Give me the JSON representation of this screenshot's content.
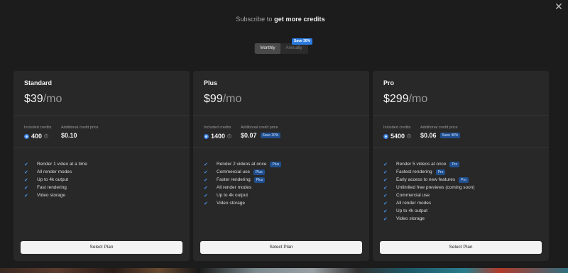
{
  "header": {
    "prefix": "Subscribe to",
    "emphasis": "get more credits"
  },
  "billing": {
    "monthly_label": "Monthly",
    "annually_label": "Annually",
    "save_badge": "Save 30%"
  },
  "labels": {
    "included_credits": "Included credits",
    "additional_price": "Additional credit price",
    "select_plan": "Select Plan"
  },
  "plans": [
    {
      "name": "Standard",
      "price": "$39",
      "unit": "/mo",
      "credits": "400",
      "additional_price": "$0.10",
      "save_chip": "",
      "features": [
        {
          "text": "Render 1 video at a time",
          "chip": ""
        },
        {
          "text": "All render modes",
          "chip": ""
        },
        {
          "text": "Up to 4k output",
          "chip": ""
        },
        {
          "text": "Fast rendering",
          "chip": ""
        },
        {
          "text": "Video storage",
          "chip": ""
        }
      ]
    },
    {
      "name": "Plus",
      "price": "$99",
      "unit": "/mo",
      "credits": "1400",
      "additional_price": "$0.07",
      "save_chip": "Save 30%",
      "features": [
        {
          "text": "Render 2 videos at once",
          "chip": "Plus"
        },
        {
          "text": "Commercial use",
          "chip": "Plus"
        },
        {
          "text": "Faster rendering",
          "chip": "Plus"
        },
        {
          "text": "All render modes",
          "chip": ""
        },
        {
          "text": "Up to 4k output",
          "chip": ""
        },
        {
          "text": "Video storage",
          "chip": ""
        }
      ]
    },
    {
      "name": "Pro",
      "price": "$299",
      "unit": "/mo",
      "credits": "5400",
      "additional_price": "$0.06",
      "save_chip": "Save 40%",
      "features": [
        {
          "text": "Render 5 videos at once",
          "chip": "Pro"
        },
        {
          "text": "Fastest rendering",
          "chip": "Pro"
        },
        {
          "text": "Early access to new features",
          "chip": "Pro"
        },
        {
          "text": "Unlimited free previews (coming soon)",
          "chip": ""
        },
        {
          "text": "Commercial use",
          "chip": ""
        },
        {
          "text": "All render modes",
          "chip": ""
        },
        {
          "text": "Up to 4k output",
          "chip": ""
        },
        {
          "text": "Video storage",
          "chip": ""
        }
      ]
    }
  ],
  "icons": {
    "close": "close-icon",
    "check": "check-icon",
    "coin": "credit-coin-icon",
    "info": "info-icon"
  },
  "colors": {
    "accent": "#3b82e6",
    "card_bg": "#282828",
    "page_bg": "#1c1c1c"
  }
}
